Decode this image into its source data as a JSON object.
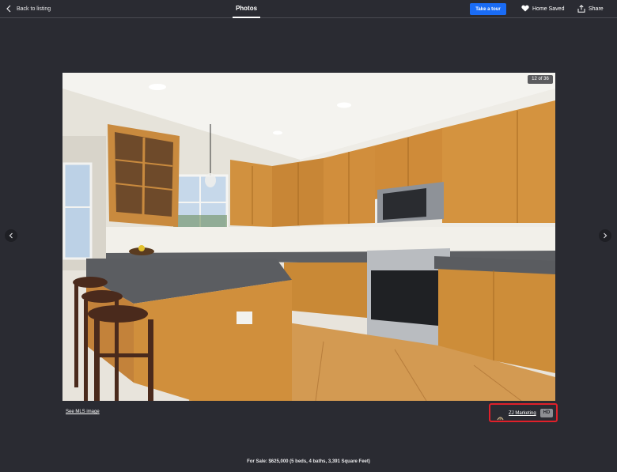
{
  "header": {
    "back_label": "Back to listing",
    "title": "Photos",
    "tour_label": "Take a tour",
    "saved_label": "Home Saved",
    "share_label": "Share"
  },
  "photo": {
    "counter": "12 of 36"
  },
  "below_photo": {
    "mls_link": "See MLS image",
    "credit_name": "ZJ Marketing",
    "hd_badge": "HD"
  },
  "footer": {
    "summary": "For Sale: $625,000 (5 beds, 4 baths, 3,391 Square Feet)"
  },
  "colors": {
    "background": "#2a2b32",
    "accent": "#1a6cf5",
    "highlight": "#e0202a"
  },
  "icons": [
    "chevron-left-icon",
    "heart-icon",
    "share-icon",
    "chevron-right-icon",
    "photographer-logo-icon"
  ]
}
